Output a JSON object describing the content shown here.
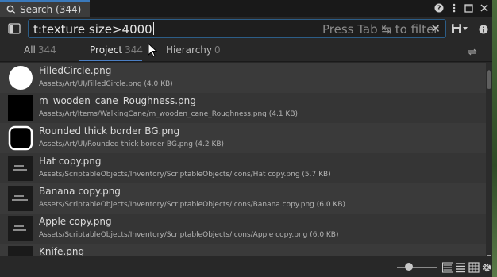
{
  "window": {
    "tab_title": "Search (344)",
    "title_icons": [
      "help-icon",
      "kebab-menu-icon",
      "maximize-icon",
      "close-icon"
    ]
  },
  "search": {
    "query": "t:texture size>4000",
    "hint": "Press Tab ↹ to filter",
    "clear_glyph": "✕"
  },
  "filters": {
    "tabs": [
      {
        "label": "All",
        "count": "344",
        "active": false
      },
      {
        "label": "Project",
        "count": "344",
        "active": true
      },
      {
        "label": "Hierarchy",
        "count": "0",
        "active": false
      }
    ]
  },
  "results": [
    {
      "name": "FilledCircle.png",
      "path": "Assets/Art/UI/FilledCircle.png (4.0 KB)",
      "thumb": "filled-circle"
    },
    {
      "name": "m_wooden_cane_Roughness.png",
      "path": "Assets/Art/Items/WalkingCane/m_wooden_cane_Roughness.png (4.1 KB)",
      "thumb": "black-square"
    },
    {
      "name": "Rounded thick border BG.png",
      "path": "Assets/Art/UI/Rounded thick border BG.png (4.2 KB)",
      "thumb": "rounded-border"
    },
    {
      "name": "Hat copy.png",
      "path": "Assets/ScriptableObjects/Inventory/ScriptableObjects/Icons/Hat copy.png (5.7 KB)",
      "thumb": "text-icon"
    },
    {
      "name": "Banana copy.png",
      "path": "Assets/ScriptableObjects/Inventory/ScriptableObjects/Icons/Banana copy.png (6.0 KB)",
      "thumb": "text-icon"
    },
    {
      "name": "Apple copy.png",
      "path": "Assets/ScriptableObjects/Inventory/ScriptableObjects/Icons/Apple copy.png (6.0 KB)",
      "thumb": "text-icon"
    },
    {
      "name": "Knife.png",
      "path": "",
      "thumb": "text-icon"
    }
  ],
  "colors": {
    "accent": "#3a79bb",
    "panel": "#282828",
    "row_even": "#3a3a3a",
    "row_odd": "#353535"
  }
}
